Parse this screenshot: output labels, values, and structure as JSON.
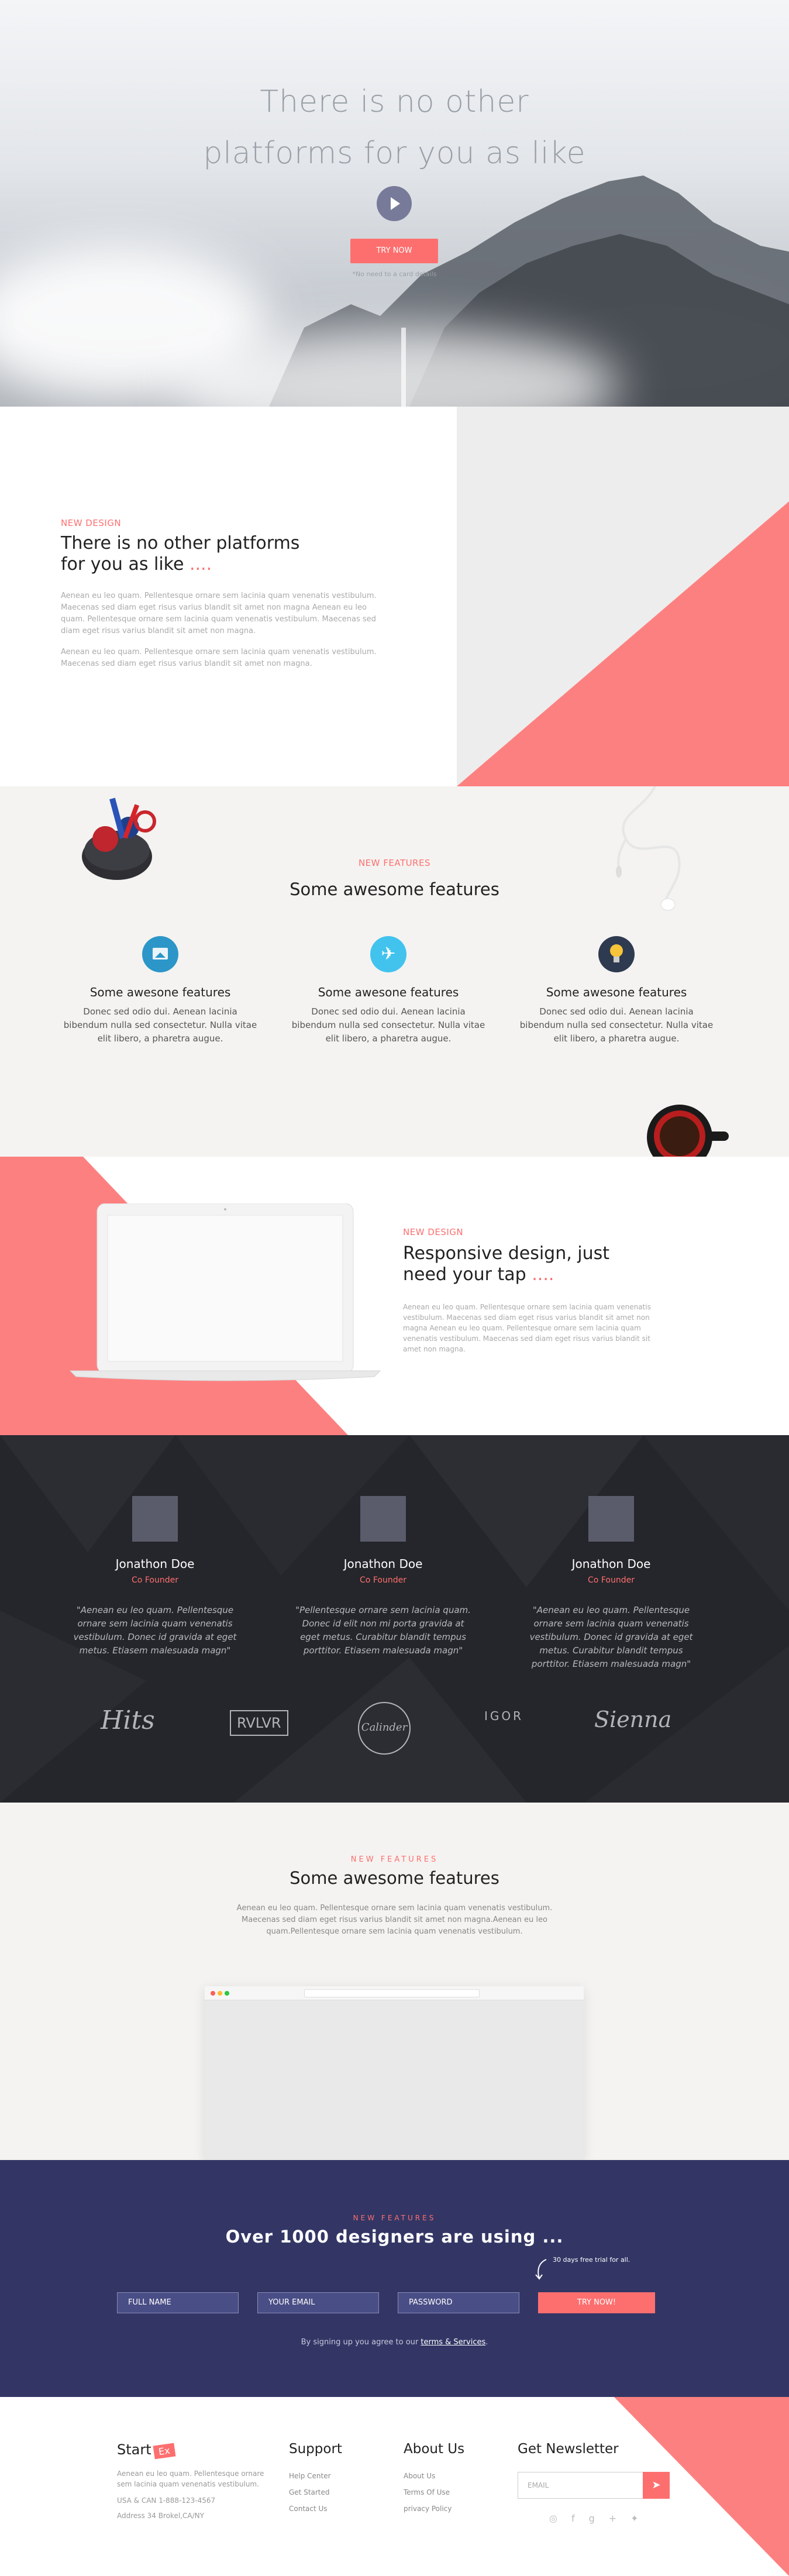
{
  "hero": {
    "title_line1": "There is no other",
    "title_line2": "platforms for you as like",
    "try_label": "TRY NOW",
    "note": "*No need to a card details"
  },
  "about": {
    "label": "NEW DESIGN",
    "title_line1": "There is no other platforms",
    "title_line2": "for you as like",
    "dots": "....",
    "para1": "Aenean eu leo quam. Pellentesque ornare sem lacinia quam venenatis vestibulum. Maecenas sed diam eget risus varius blandit sit amet non magna Aenean eu leo quam. Pellentesque ornare sem lacinia quam venenatis vestibulum. Maecenas sed diam eget risus varius blandit sit amet non magna.",
    "para2": "Aenean eu leo quam. Pellentesque ornare sem lacinia quam venenatis vestibulum. Maecenas sed diam eget risus varius blandit sit amet non magna.",
    "accent": "#fd8080"
  },
  "features": {
    "label": "NEW FEATURES",
    "title": "Some awesome features",
    "items": [
      {
        "icon": "picture-icon",
        "title": "Some awesone features",
        "text": "Donec sed odio dui. Aenean lacinia bibendum nulla sed consectetur. Nulla vitae elit libero, a pharetra augue."
      },
      {
        "icon": "airplane-icon",
        "title": "Some awesone features",
        "text": "Donec sed odio dui. Aenean lacinia bibendum nulla sed consectetur. Nulla vitae elit libero, a pharetra augue."
      },
      {
        "icon": "lightbulb-icon",
        "title": "Some awesone features",
        "text": "Donec sed odio dui. Aenean lacinia bibendum nulla sed consectetur. Nulla vitae elit libero, a pharetra augue."
      }
    ]
  },
  "responsive": {
    "label": "NEW DESIGN",
    "title_line1": "Responsive design, just",
    "title_line2": "need your tap",
    "dots": "....",
    "para": "Aenean eu leo quam. Pellentesque ornare sem lacinia quam venenatis vestibulum. Maecenas sed diam eget risus varius blandit sit amet non magna Aenean eu leo quam. Pellentesque ornare sem lacinia quam venenatis vestibulum. Maecenas sed diam eget risus varius blandit sit amet non magna."
  },
  "team": {
    "members": [
      {
        "name": "Jonathon Doe",
        "role": "Co Founder",
        "quote": "\"Aenean eu leo quam. Pellentesque ornare sem lacinia quam venenatis vestibulum. Donec id gravida at eget metus. Etiasem malesuada magn\""
      },
      {
        "name": "Jonathon Doe",
        "role": "Co Founder",
        "quote": "\"Pellentesque ornare sem lacinia quam. Donec id elit non mi porta gravida at eget metus. Curabitur blandit tempus porttitor. Etiasem malesuada magn\""
      },
      {
        "name": "Jonathon Doe",
        "role": "Co Founder",
        "quote": "\"Aenean eu leo quam. Pellentesque ornare sem lacinia quam venenatis vestibulum. Donec id gravida at eget metus. Curabitur blandit tempus porttitor. Etiasem malesuada magn\""
      }
    ],
    "logos": [
      "Hits",
      "RVLVR",
      "Calinder",
      "IGOR",
      "Sienna"
    ]
  },
  "more": {
    "label": "NEW FEATURES",
    "title": "Some awesome features",
    "para": "Aenean eu leo quam. Pellentesque ornare sem lacinia quam venenatis vestibulum. Maecenas sed diam eget risus varius blandit sit amet non magna.Aenean eu leo quam.Pellentesque ornare sem lacinia quam venenatis vestibulum."
  },
  "signup": {
    "label": "NEW FEATURES",
    "title": "Over 1000 designers are using ...",
    "trial": "30 days free trial for all.",
    "fullname_placeholder": "FULL NAME",
    "email_placeholder": "YOUR EMAIL",
    "password_placeholder": "PASSWORD",
    "try_label": "TRY NOW!",
    "terms_prefix": "By signing up you agree to our ",
    "terms_link": "terms & Services",
    "terms_suffix": "."
  },
  "footer": {
    "brand": "Start",
    "brand_badge": "Ex",
    "about_text": "Aenean eu leo quam. Pellentesque ornare sem lacinia quam venenatis vestibulum.",
    "phone": "USA & CAN 1-888-123-4567",
    "address": "Address 34 Brokel,CA/NY",
    "support_title": "Support",
    "support_links": [
      "Help Center",
      "Get Started",
      "Contact Us"
    ],
    "about_title": "About Us",
    "about_links": [
      "About Us",
      "Terms Of Use",
      "privacy Policy"
    ],
    "newsletter_title": "Get Newsletter",
    "email_placeholder": "EMAIL",
    "social": [
      "dribbble-icon",
      "facebook-icon",
      "google-plus-icon",
      "twitter-icon"
    ]
  }
}
